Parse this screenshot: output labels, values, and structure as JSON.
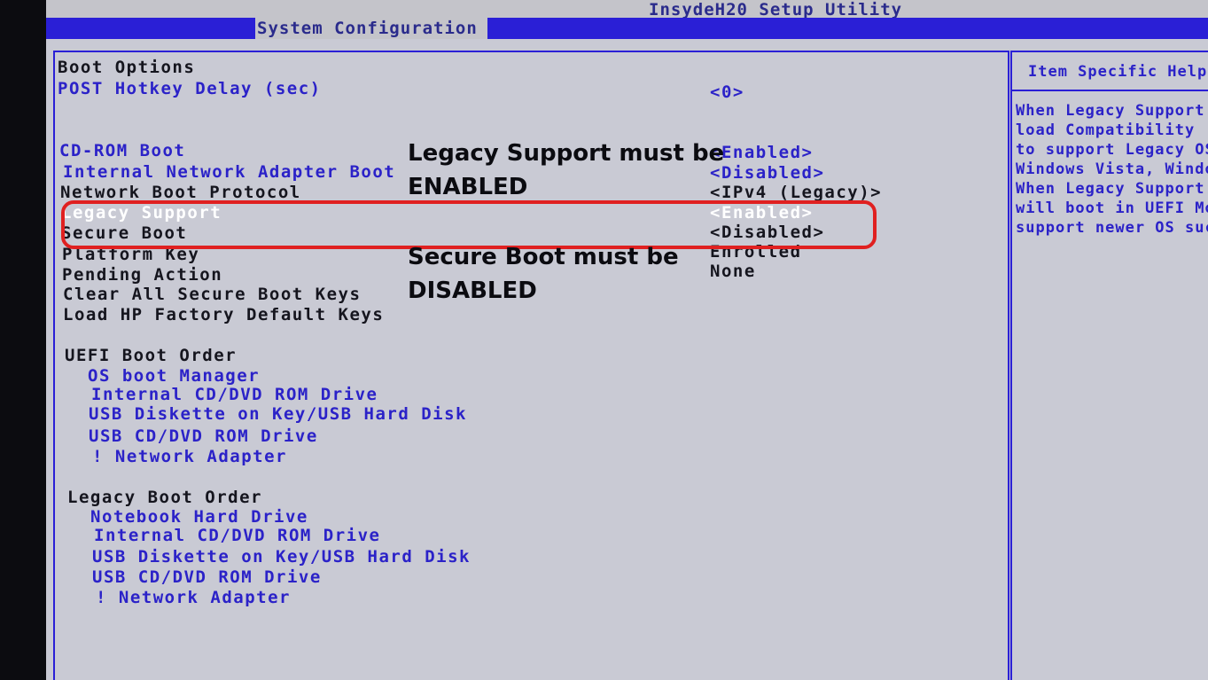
{
  "title": "InsydeH20 Setup Utility",
  "menu": {
    "active_tab": "System Configuration"
  },
  "boot_options": {
    "heading": "Boot Options",
    "post_hotkey_delay": {
      "label": "POST Hotkey Delay (sec)",
      "value": "<0>"
    },
    "cdrom_boot": {
      "label": "CD-ROM Boot",
      "value": "<Enabled>"
    },
    "internal_network_adapter_boot": {
      "label": "Internal Network Adapter Boot",
      "value": "<Disabled>"
    },
    "network_boot_protocol": {
      "label": "Network Boot Protocol",
      "value": "<IPv4 (Legacy)>"
    },
    "legacy_support": {
      "label": "Legacy Support",
      "value": "<Enabled>"
    },
    "secure_boot": {
      "label": "Secure Boot",
      "value": "<Disabled>"
    },
    "platform_key": {
      "label": "Platform Key",
      "value": "Enrolled"
    },
    "pending_action": {
      "label": "Pending Action",
      "value": "None"
    },
    "clear_keys": {
      "label": "Clear All Secure Boot Keys"
    },
    "load_hp_keys": {
      "label": "Load HP Factory Default Keys"
    }
  },
  "uefi_boot_order": {
    "heading": "UEFI Boot Order",
    "items": [
      "OS boot Manager",
      "Internal CD/DVD ROM Drive",
      "USB Diskette on Key/USB Hard Disk",
      "USB CD/DVD ROM Drive",
      "! Network Adapter"
    ]
  },
  "legacy_boot_order": {
    "heading": "Legacy Boot Order",
    "items": [
      "Notebook Hard Drive",
      "Internal CD/DVD ROM Drive",
      "USB Diskette on Key/USB Hard Disk",
      "USB CD/DVD ROM Drive",
      "! Network Adapter"
    ]
  },
  "help_panel": {
    "heading": "Item Specific Help",
    "lines": [
      "When Legacy Support",
      "load Compatibility",
      "to support Legacy OS",
      "Windows Vista, Windows",
      "When Legacy Support",
      "will boot in UEFI Mode",
      "support newer OS such"
    ]
  },
  "annotations": {
    "legacy_note_line1": "Legacy Support must be",
    "legacy_note_line2": "ENABLED",
    "secure_note_line1": "Secure Boot must be",
    "secure_note_line2": "DISABLED",
    "highlight_color": "#e02020"
  },
  "colors": {
    "screen_bg": "#c9cad4",
    "accent_blue": "#2a1fd6",
    "option_blue": "#2b22c8",
    "heading_dark": "#15151e",
    "selected_white": "#ffffff"
  }
}
